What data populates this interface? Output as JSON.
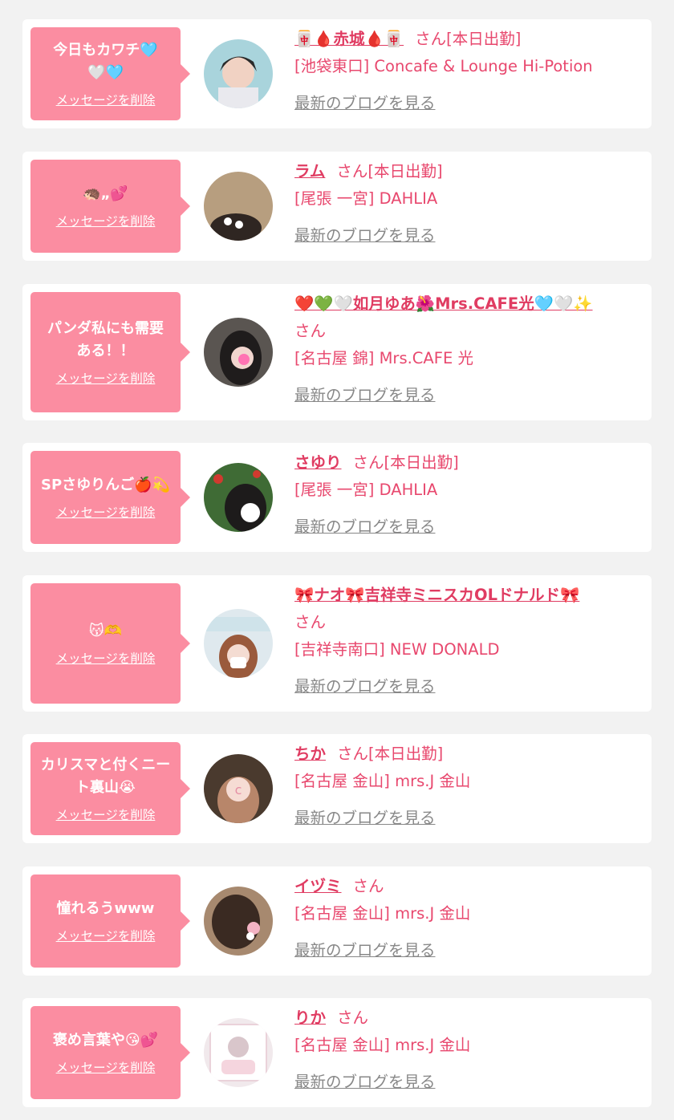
{
  "colors": {
    "accent": "#fb8da1",
    "name_text": "#e03c62",
    "shop_text": "#e8486e",
    "blog_link": "#888888",
    "page_bg": "#f2f2f2",
    "card_bg": "#ffffff"
  },
  "entries": [
    {
      "message": "今日もカワチ🩵🤍🩵",
      "delete_label": "メッセージを削除",
      "name": "🀄🩸赤城🩸🀄",
      "honorific": "さん[本日出勤]",
      "shop": "[池袋東口] Concafe & Lounge Hi-Potion",
      "blog_link": "最新のブログを見る"
    },
    {
      "message": "🦔„💕",
      "delete_label": "メッセージを削除",
      "name": "ラム",
      "honorific": "さん[本日出勤]",
      "shop": "[尾張 一宮] DAHLIA",
      "blog_link": "最新のブログを見る"
    },
    {
      "message": "パンダ私にも需要ある！！",
      "delete_label": "メッセージを削除",
      "name": "❤️💚🤍如月ゆあ🌺Mrs.CAFE光🩵🤍✨",
      "honorific": "さん",
      "shop": "[名古屋 錦] Mrs.CAFE 光",
      "blog_link": "最新のブログを見る"
    },
    {
      "message": "SPさゆりんご🍎💫",
      "delete_label": "メッセージを削除",
      "name": "さゆり",
      "honorific": "さん[本日出勤]",
      "shop": "[尾張 一宮] DAHLIA",
      "blog_link": "最新のブログを見る"
    },
    {
      "message": "😽🫶",
      "delete_label": "メッセージを削除",
      "name": "🎀ナオ🎀吉祥寺ミニスカOLドナルド🎀",
      "honorific": "さん",
      "shop": "[吉祥寺南口] NEW DONALD",
      "blog_link": "最新のブログを見る"
    },
    {
      "message": "カリスマと付くニート裏山😭",
      "delete_label": "メッセージを削除",
      "name": "ちか",
      "honorific": "さん[本日出勤]",
      "shop": "[名古屋 金山] mrs.J 金山",
      "blog_link": "最新のブログを見る"
    },
    {
      "message": "憧れるうwww",
      "delete_label": "メッセージを削除",
      "name": "イヅミ",
      "honorific": "さん",
      "shop": "[名古屋 金山] mrs.J 金山",
      "blog_link": "最新のブログを見る"
    },
    {
      "message": "褒め言葉や😘💕",
      "delete_label": "メッセージを削除",
      "name": "りか",
      "honorific": "さん",
      "shop": "[名古屋 金山] mrs.J 金山",
      "blog_link": "最新のブログを見る"
    }
  ]
}
